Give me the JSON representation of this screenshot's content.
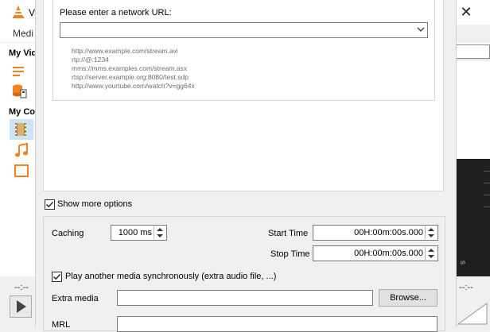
{
  "background_window": {
    "title_fragment": "V",
    "menu_fragment": "Medi",
    "sidebar": {
      "heading_1": "My Vid",
      "heading_2": "My Co"
    },
    "time_left": "--:--",
    "time_right": "--:--",
    "close_glyph": "✕",
    "right_dark_fragment": "s"
  },
  "dialog": {
    "network": {
      "url_label": "Please enter a network URL:",
      "url_value": "",
      "examples": [
        "http://www.example.com/stream.avi",
        "rtp://@:1234",
        "mms://mms.examples.com/stream.asx",
        "rtsp://server.example.org:8080/test.sdp",
        "http://www.yourtube.com/watch?v=gg64x"
      ]
    },
    "show_more_options": {
      "label": "Show more options",
      "checked": true
    },
    "options": {
      "caching_label": "Caching",
      "caching_value": "1000 ms",
      "start_time_label": "Start Time",
      "start_time_value": "00H:00m:00s.000",
      "stop_time_label": "Stop Time",
      "stop_time_value": "00H:00m:00s.000",
      "sync_label": "Play another media synchronously (extra audio file, ...)",
      "sync_checked": true,
      "extra_media_label": "Extra media",
      "extra_media_value": "",
      "browse_label": "Browse...",
      "mrl_label": "MRL",
      "mrl_value": ""
    }
  },
  "colors": {
    "vlc_orange": "#f58220",
    "dialog_bg": "#f0f0f0",
    "content_bg": "#ffffff"
  }
}
